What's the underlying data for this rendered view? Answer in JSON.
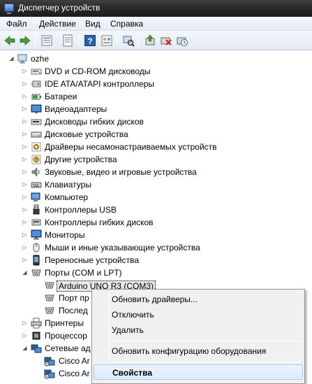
{
  "window": {
    "title": "Диспетчер устройств"
  },
  "menu": [
    "Файл",
    "Действие",
    "Вид",
    "Справка"
  ],
  "toolbar": {
    "icons": [
      "back-icon",
      "forward-icon",
      "properties-grid-icon",
      "properties-icon",
      "help-icon",
      "show-hidden-icon",
      "scan-hardware-icon",
      "update-driver-icon",
      "disable-device-icon",
      "uninstall-icon"
    ]
  },
  "tree": {
    "root": "ozhe",
    "categories": [
      {
        "label": "DVD и CD-ROM дисководы",
        "icon": "dvd-icon"
      },
      {
        "label": "IDE ATA/ATAPI контроллеры",
        "icon": "ide-controller-icon"
      },
      {
        "label": "Батареи",
        "icon": "battery-icon"
      },
      {
        "label": "Видеоадаптеры",
        "icon": "display-adapter-icon"
      },
      {
        "label": "Дисководы гибких дисков",
        "icon": "floppy-drive-icon"
      },
      {
        "label": "Дисковые устройства",
        "icon": "disk-drive-icon"
      },
      {
        "label": "Драйверы несамонастраиваемых устройств",
        "icon": "non-pnp-driver-icon"
      },
      {
        "label": "Другие устройства",
        "icon": "other-devices-icon"
      },
      {
        "label": "Звуковые, видео и игровые устройства",
        "icon": "speaker-icon"
      },
      {
        "label": "Клавиатуры",
        "icon": "keyboard-icon"
      },
      {
        "label": "Компьютер",
        "icon": "computer-icon"
      },
      {
        "label": "Контроллеры USB",
        "icon": "usb-icon"
      },
      {
        "label": "Контроллеры гибких дисков",
        "icon": "floppy-controller-icon"
      },
      {
        "label": "Мониторы",
        "icon": "monitor-icon"
      },
      {
        "label": "Мыши и иные указывающие устройства",
        "icon": "mouse-icon"
      },
      {
        "label": "Переносные устройства",
        "icon": "portable-device-icon"
      }
    ],
    "ports": {
      "label": "Порты (COM и LPT)",
      "children": [
        "Arduino UNO R3 (COM3)",
        "Порт пр",
        "Послед"
      ]
    },
    "after_ports": [
      {
        "label": "Принтеры",
        "icon": "printer-icon"
      },
      {
        "label": "Процессор",
        "icon": "processor-icon"
      }
    ],
    "network": {
      "label": "Сетевые ад",
      "children": [
        "Cisco Ar",
        "Cisco Ar"
      ]
    }
  },
  "context_menu": {
    "items": [
      "Обновить драйверы...",
      "Отключить",
      "Удалить",
      "Обновить конфигурацию оборудования",
      "Свойства"
    ]
  },
  "colors": {
    "titlebar": "#262626",
    "selection": "#dcebfc",
    "accent": "#3b74c4"
  }
}
